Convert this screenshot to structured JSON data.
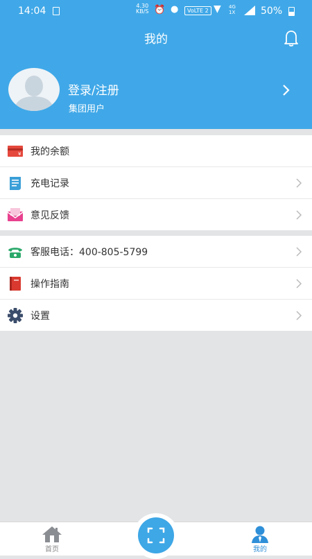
{
  "status_bar": {
    "time": "14:04",
    "speed": "4.30\nKB/S",
    "volte": "VoLTE 2",
    "network": "4G\n1X",
    "battery": "50%"
  },
  "header": {
    "title": "我的"
  },
  "profile": {
    "login_label": "登录/注册",
    "user_type": "集团用户"
  },
  "menu_section_1": [
    {
      "label": "我的余额",
      "icon": "balance-wallet-icon",
      "color": "#e5483c"
    },
    {
      "label": "充电记录",
      "icon": "charge-record-icon",
      "color": "#3b9fd8"
    },
    {
      "label": "意见反馈",
      "icon": "feedback-envelope-icon",
      "color": "#e8418f"
    }
  ],
  "menu_section_2": [
    {
      "label": "客服电话：400-805-5799",
      "icon": "phone-icon",
      "color": "#2aa86a"
    },
    {
      "label": "操作指南",
      "icon": "guide-book-icon",
      "color": "#d9392f"
    },
    {
      "label": "设置",
      "icon": "gear-icon",
      "color": "#3b4d6b"
    }
  ],
  "tabbar": {
    "home_label": "首页",
    "mine_label": "我的",
    "active_color": "#2f8fd8"
  },
  "colors": {
    "header_bg": "#40a8e8",
    "page_bg": "#e3e4e6"
  }
}
